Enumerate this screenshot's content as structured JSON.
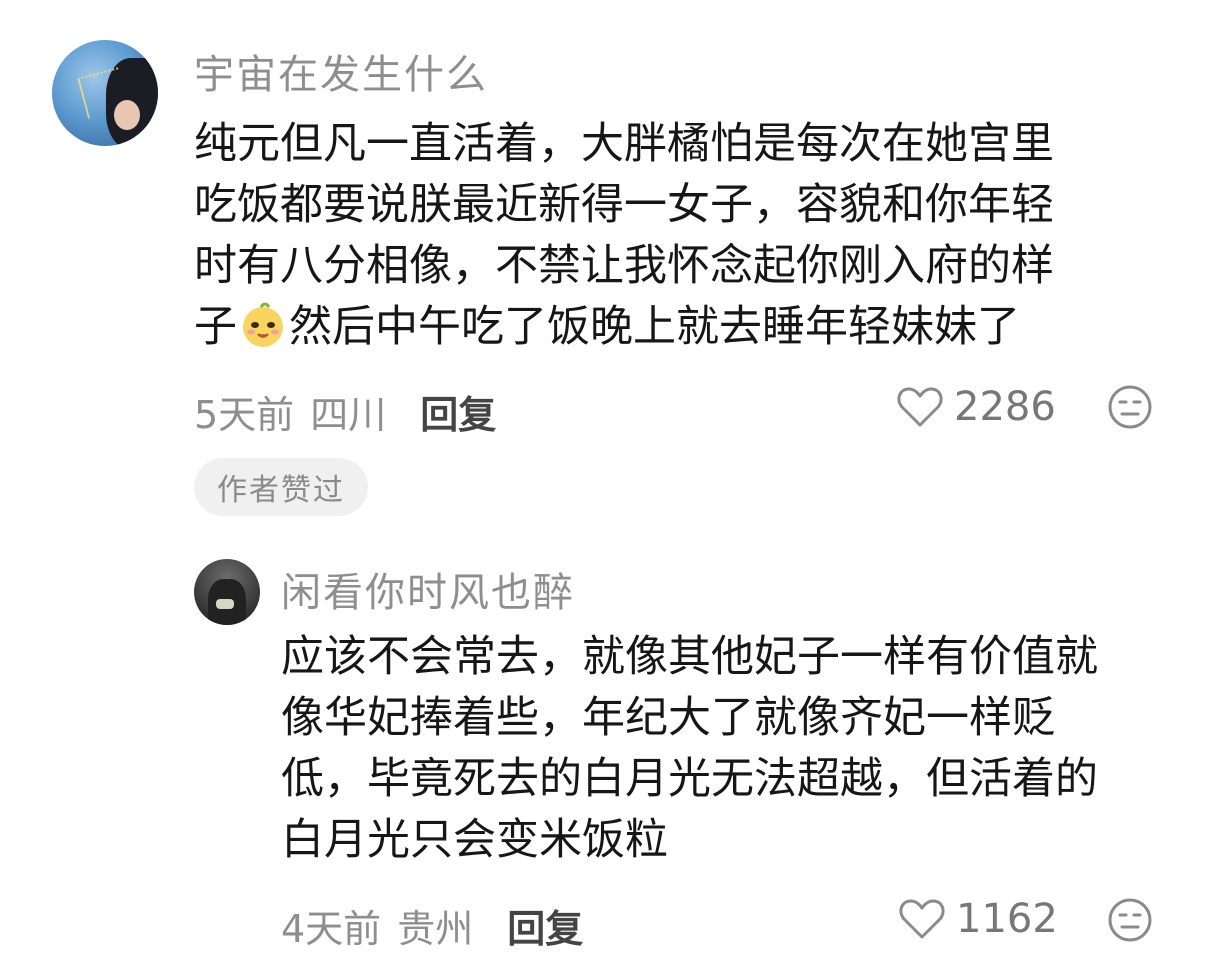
{
  "comments": [
    {
      "username": "宇宙在发生什么",
      "lines": [
        "纯元但凡一直活着，大胖橘怕是每次在她宫里",
        "吃饭都要说朕最近新得一女子，容貌和你年轻",
        "时有八分相像，不禁让我怀念起你刚入府的样",
        "子"
      ],
      "line4_after_emoji": "然后中午吃了饭晚上就去睡年轻妹妹了",
      "emoji_icon": "smirk-sticker-icon",
      "time": "5天前",
      "location": "四川",
      "reply_label": "回复",
      "like_count": "2286",
      "badge": "作者赞过"
    },
    {
      "username": "闲看你时风也醉",
      "lines": [
        "应该不会常去，就像其他妃子一样有价值就",
        "像华妃捧着些，年纪大了就像齐妃一样贬",
        "低，毕竟死去的白月光无法超越，但活着的",
        "白月光只会变米饭粒"
      ],
      "time": "4天前",
      "location": "贵州",
      "reply_label": "回复",
      "like_count": "1162"
    }
  ],
  "icons": {
    "like": "heart-outline-icon",
    "dislike": "meh-face-icon"
  },
  "colors": {
    "text": "#161616",
    "muted": "#8e8e8e",
    "badge_bg": "#f0f0f0"
  }
}
